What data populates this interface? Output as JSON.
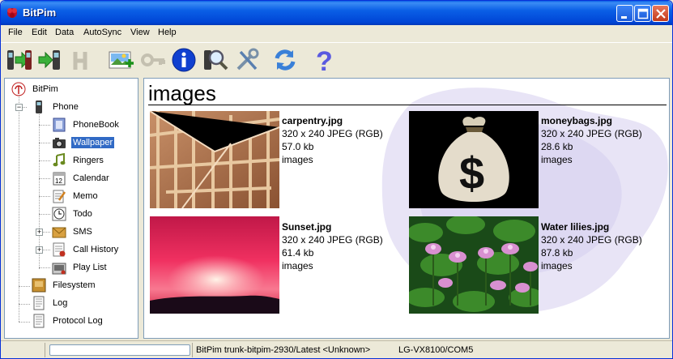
{
  "window": {
    "title": "BitPim",
    "accent": "#0a5fe6"
  },
  "menu": [
    {
      "label": "File"
    },
    {
      "label": "Edit"
    },
    {
      "label": "Data"
    },
    {
      "label": "AutoSync"
    },
    {
      "label": "View"
    },
    {
      "label": "Help"
    }
  ],
  "toolbar": [
    {
      "icon": "get-phone-data-icon"
    },
    {
      "icon": "send-phone-data-icon"
    },
    {
      "icon": "history-icon"
    },
    {
      "icon": "add-wallpaper-icon"
    },
    {
      "icon": "key-icon"
    },
    {
      "icon": "info-icon"
    },
    {
      "icon": "detect-phone-icon"
    },
    {
      "icon": "settings-tools-icon"
    },
    {
      "icon": "refresh-icon"
    },
    {
      "icon": "help-icon"
    }
  ],
  "tree": {
    "root": "BitPim",
    "phone": "Phone",
    "items": [
      {
        "label": "PhoneBook"
      },
      {
        "label": "Wallpaper"
      },
      {
        "label": "Ringers"
      },
      {
        "label": "Calendar"
      },
      {
        "label": "Memo"
      },
      {
        "label": "Todo"
      },
      {
        "label": "SMS"
      },
      {
        "label": "Call History"
      },
      {
        "label": "Play List"
      }
    ],
    "filesystem": "Filesystem",
    "log": "Log",
    "protocol_log": "Protocol Log",
    "selected": "Wallpaper"
  },
  "content": {
    "title": "images",
    "images": [
      {
        "name": "carpentry.jpg",
        "dims": "320 x 240 JPEG (RGB)",
        "size": "57.0 kb",
        "origin": "images"
      },
      {
        "name": "moneybags.jpg",
        "dims": "320 x 240 JPEG (RGB)",
        "size": "28.6 kb",
        "origin": "images"
      },
      {
        "name": "Sunset.jpg",
        "dims": "320 x 240 JPEG (RGB)",
        "size": "61.4 kb",
        "origin": "images"
      },
      {
        "name": "Water lilies.jpg",
        "dims": "320 x 240 JPEG (RGB)",
        "size": "87.8 kb",
        "origin": "images"
      }
    ]
  },
  "status": {
    "version": "BitPim trunk-bitpim-2930/Latest <Unknown>",
    "phone": "LG-VX8100/COM5"
  }
}
